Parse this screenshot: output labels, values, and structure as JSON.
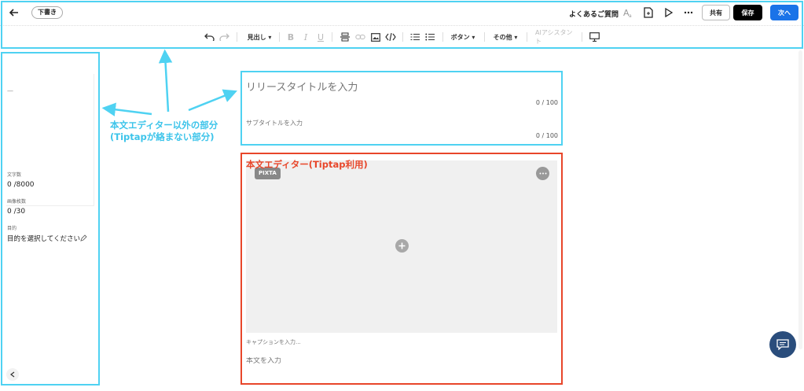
{
  "header": {
    "draft_label": "下書き",
    "faq_label": "よくあるご質問",
    "share_label": "共有",
    "save_label": "保存",
    "next_label": "次へ"
  },
  "toolbar": {
    "heading_label": "見出し ▾",
    "bold": "B",
    "italic": "I",
    "underline": "U",
    "button_label": "ボタン ▾",
    "other_label": "その他 ▾",
    "ai_label": "AIアシスタント"
  },
  "sidebar": {
    "preview_placeholder": "—",
    "char_count_label": "文字数",
    "char_count_value": "0 /8000",
    "image_count_label": "画像枚数",
    "image_count_value": "0 /30",
    "purpose_label": "目的",
    "purpose_value": "目的を選択してください"
  },
  "title_area": {
    "title_placeholder": "リリースタイトルを入力",
    "title_counter": "0 / 100",
    "subtitle_placeholder": "サブタイトルを入力",
    "subtitle_counter": "0 / 100"
  },
  "editor": {
    "pixta_label": "PIXTA",
    "caption_placeholder": "キャプションを入力...",
    "body_placeholder": "本文を入力"
  },
  "annotations": {
    "blue_note_line1": "本文エディター以外の部分",
    "blue_note_line2": "(Tiptapが絡まない部分)",
    "red_note": "本文エディター(Tiptap利用)",
    "blue_color": "#4fd2f2",
    "red_color": "#e8462a"
  },
  "colors": {
    "next_button": "#1a73e8",
    "save_button": "#000000",
    "chat_fab": "#2a4d7c"
  }
}
